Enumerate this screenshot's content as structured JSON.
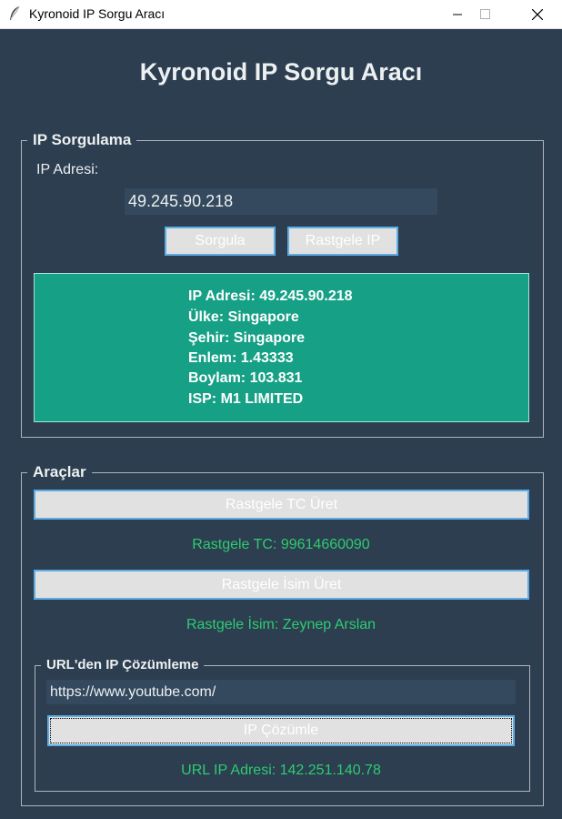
{
  "window": {
    "title": "Kyronoid IP Sorgu Aracı",
    "controls": [
      "minimize",
      "maximize",
      "close"
    ]
  },
  "heading": "Kyronoid IP Sorgu Aracı",
  "ip_section": {
    "title": "IP Sorgulama",
    "field_label": "IP Adresi:",
    "ip_value": "49.245.90.218",
    "query_button": "Sorgula",
    "random_ip_button": "Rastgele IP",
    "result": {
      "ip": "IP Adresi: 49.245.90.218",
      "country": "Ülke: Singapore",
      "city": "Şehir: Singapore",
      "lat": "Enlem: 1.43333",
      "lon": "Boylam: 103.831",
      "isp": "ISP: M1 LIMITED"
    }
  },
  "tools_section": {
    "title": "Araçlar",
    "tc_button": "Rastgele TC Üret",
    "tc_result": "Rastgele TC: 99614660090",
    "name_button": "Rastgele İsim Üret",
    "name_result": "Rastgele İsim: Zeynep Arslan"
  },
  "url_section": {
    "title": "URL'den IP Çözümleme",
    "url_value": "https://www.youtube.com/",
    "resolve_button": "IP Çözümle",
    "url_result": "URL IP Adresi: 142.251.140.78"
  },
  "colors": {
    "background": "#2c3e50",
    "entry": "#34495e",
    "result_box": "#16a085",
    "accent_green": "#2ecc71",
    "button_border": "#5dade2"
  }
}
